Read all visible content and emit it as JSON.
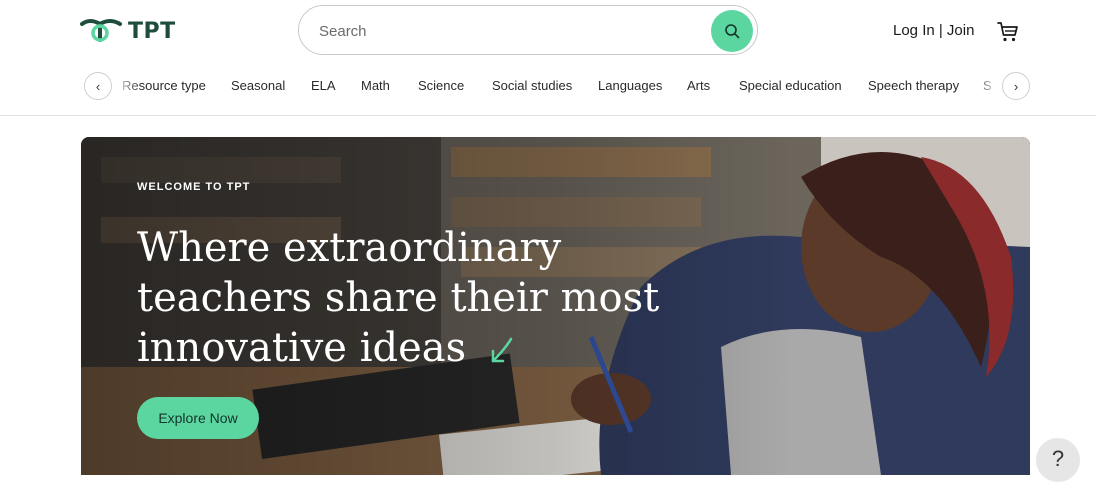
{
  "brand": {
    "name": "TPT",
    "accent": "#5cd6a0",
    "logo_color": "#1f4d3d"
  },
  "search": {
    "placeholder": "Search",
    "value": "",
    "icon": "search-icon"
  },
  "account": {
    "login_label": "Log In | Join",
    "cart_icon": "cart-icon"
  },
  "nav": {
    "prev_icon": "chevron-left-icon",
    "next_icon": "chevron-right-icon",
    "items": [
      {
        "label": "Resource type"
      },
      {
        "label": "Seasonal"
      },
      {
        "label": "ELA"
      },
      {
        "label": "Math"
      },
      {
        "label": "Science"
      },
      {
        "label": "Social studies"
      },
      {
        "label": "Languages"
      },
      {
        "label": "Arts"
      },
      {
        "label": "Special education"
      },
      {
        "label": "Speech therapy"
      },
      {
        "label": "S"
      }
    ]
  },
  "hero": {
    "eyebrow": "WELCOME TO TPT",
    "headline_lines": [
      "Where extraordinary",
      "teachers share their most",
      "innovative ideas"
    ],
    "cta_label": "Explore Now"
  },
  "help": {
    "label": "?"
  }
}
